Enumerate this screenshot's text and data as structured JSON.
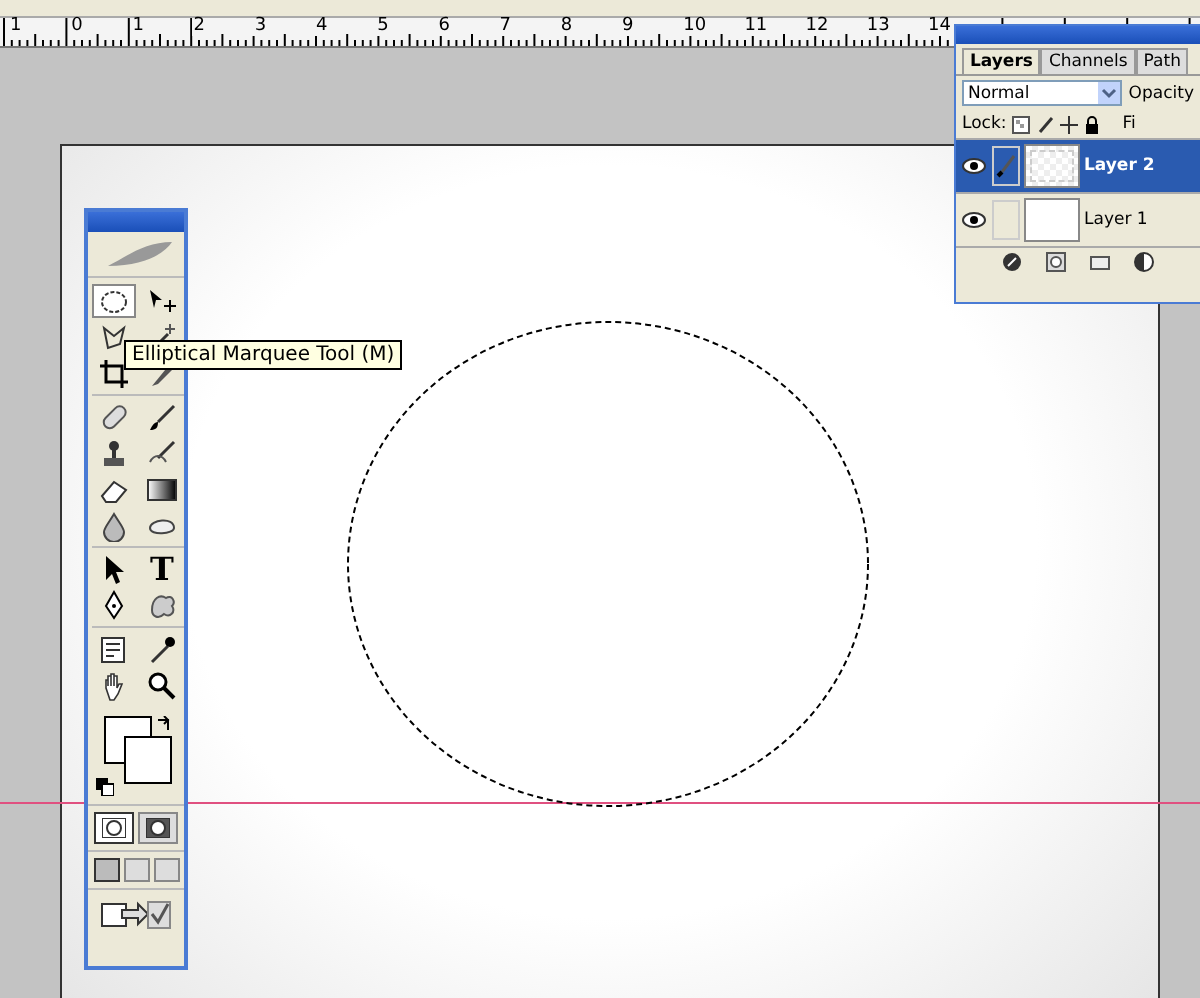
{
  "ruler": {
    "labels": [
      "1",
      "0",
      "1",
      "2",
      "3",
      "4",
      "5",
      "6",
      "7",
      "8",
      "9",
      "10",
      "11",
      "12",
      "13",
      "14"
    ]
  },
  "toolbox": {
    "tools": [
      {
        "kind": "marquee",
        "selected": true
      },
      {
        "kind": "move",
        "selected": false
      },
      {
        "kind": "lasso",
        "selected": false
      },
      {
        "kind": "wand",
        "selected": false
      },
      {
        "kind": "crop",
        "selected": false
      },
      {
        "kind": "slice",
        "selected": false
      },
      {
        "kind": "heal",
        "selected": false
      },
      {
        "kind": "brush",
        "selected": false
      },
      {
        "kind": "stamp",
        "selected": false
      },
      {
        "kind": "historybrush",
        "selected": false
      },
      {
        "kind": "eraser",
        "selected": false
      },
      {
        "kind": "gradient",
        "selected": false
      },
      {
        "kind": "blur",
        "selected": false
      },
      {
        "kind": "dodge",
        "selected": false
      },
      {
        "kind": "select",
        "selected": false
      },
      {
        "kind": "type",
        "label": "T",
        "selected": false
      },
      {
        "kind": "pen",
        "selected": false
      },
      {
        "kind": "shape",
        "selected": false
      },
      {
        "kind": "notes",
        "selected": false
      },
      {
        "kind": "eyedropper",
        "selected": false
      },
      {
        "kind": "hand",
        "selected": false
      },
      {
        "kind": "zoom",
        "selected": false
      }
    ],
    "quick_mask": [
      {
        "selected": true
      },
      {
        "selected": false
      }
    ],
    "screen_modes": [
      {
        "selected": true
      },
      {
        "selected": false
      },
      {
        "selected": false
      }
    ]
  },
  "tooltip": {
    "text": "Elliptical Marquee Tool (M)"
  },
  "layers_panel": {
    "tabs": [
      {
        "label": "Layers",
        "selected": true
      },
      {
        "label": "Channels",
        "selected": false
      },
      {
        "label": "Path",
        "selected": false
      }
    ],
    "blend_mode": "Normal",
    "opacity_label": "Opacity",
    "lock_label": "Lock:",
    "fill_label": "Fi",
    "layers": [
      {
        "name": "Layer 2",
        "visible": true,
        "selected": true,
        "linked_brush": true,
        "transparent": true
      },
      {
        "name": "Layer 1",
        "visible": true,
        "selected": false,
        "linked_brush": false,
        "transparent": false
      }
    ]
  }
}
